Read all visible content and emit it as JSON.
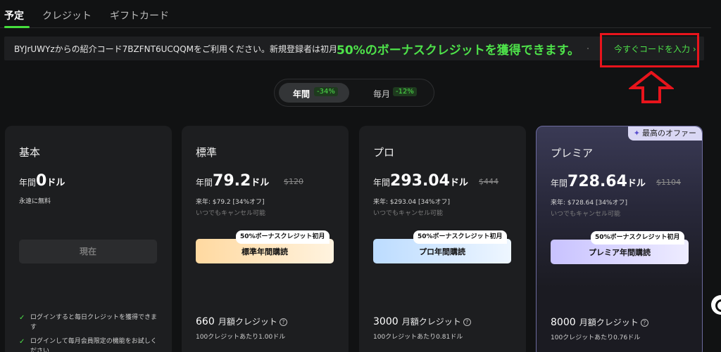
{
  "tabs": [
    {
      "label": "予定",
      "active": true
    },
    {
      "label": "クレジット",
      "active": false
    },
    {
      "label": "ギフトカード",
      "active": false
    }
  ],
  "banner": {
    "text": "BYJrUWYzからの紹介コード7BZFNT6UCQQMをご利用ください。新規登録者は初月",
    "highlight": "50%のボーナスクレジットを獲得できます。",
    "cta": "今すぐコードを入力 ›"
  },
  "billing_toggle": {
    "yearly": {
      "label": "年間",
      "discount": "-34%",
      "selected": true
    },
    "monthly": {
      "label": "毎月",
      "discount": "-12%",
      "selected": false
    }
  },
  "plans": [
    {
      "name": "基本",
      "price_prefix": "年間",
      "price": "0",
      "price_unit": "ドル",
      "note": "永遠に無料",
      "button": "現在",
      "features": [
        "ログインすると毎日クレジットを獲得できます",
        "ログインして毎月会員限定の機能をお試しください"
      ]
    },
    {
      "name": "標準",
      "price_prefix": "年間",
      "price": "79.2",
      "price_unit": "ドル",
      "original_price": "$120",
      "billing_note": "来年: $79.2 [34%オフ]",
      "cancel_note": "いつでもキャンセル可能",
      "bonus_tag": "50%ボーナスクレジット初月",
      "button": "標準年間購読",
      "credits": "660",
      "credits_unit": "月額クレジット",
      "per_100": "100クレジットあたり1.00ドル"
    },
    {
      "name": "プロ",
      "price_prefix": "年間",
      "price": "293.04",
      "price_unit": "ドル",
      "original_price": "$444",
      "billing_note": "来年: $293.04 [34%オフ]",
      "cancel_note": "いつでもキャンセル可能",
      "bonus_tag": "50%ボーナスクレジット初月",
      "button": "プロ年間購読",
      "credits": "3000",
      "credits_unit": "月額クレジット",
      "per_100": "100クレジットあたり0.81ドル"
    },
    {
      "name": "プレミア",
      "price_prefix": "年間",
      "price": "728.64",
      "price_unit": "ドル",
      "original_price": "$1104",
      "billing_note": "来年: $728.64 [34%オフ]",
      "cancel_note": "いつでもキャンセル可能",
      "bonus_tag": "50%ボーナスクレジット初月",
      "button": "プレミア年間購読",
      "credits": "8000",
      "credits_unit": "月額クレジット",
      "per_100": "100クレジットあたり0.76ドル",
      "badge": "最高のオファー"
    }
  ],
  "colors": {
    "accent": "#4ee24a",
    "annotation": "#e8141c",
    "background": "#111213"
  }
}
